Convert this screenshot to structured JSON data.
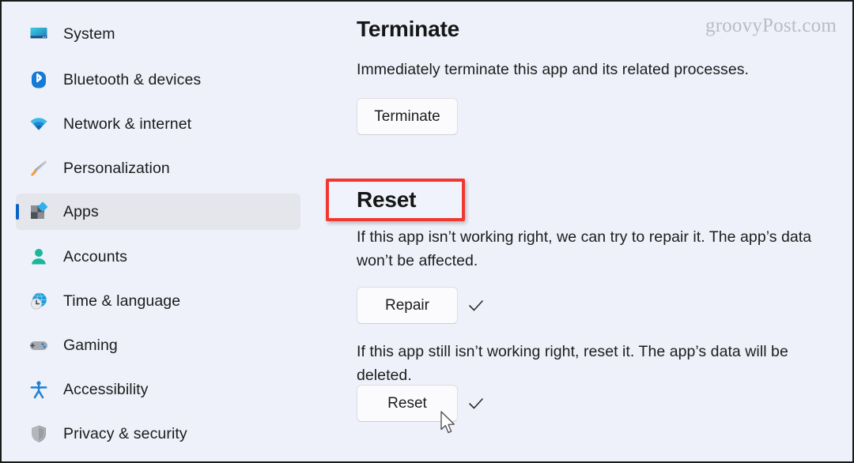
{
  "watermark": "groovyPost.com",
  "sidebar": {
    "items": [
      {
        "label": "System",
        "icon": "monitor-icon",
        "selected": false
      },
      {
        "label": "Bluetooth & devices",
        "icon": "bluetooth-icon",
        "selected": false
      },
      {
        "label": "Network & internet",
        "icon": "wifi-icon",
        "selected": false
      },
      {
        "label": "Personalization",
        "icon": "paintbrush-icon",
        "selected": false
      },
      {
        "label": "Apps",
        "icon": "apps-icon",
        "selected": true
      },
      {
        "label": "Accounts",
        "icon": "person-icon",
        "selected": false
      },
      {
        "label": "Time & language",
        "icon": "clock-globe-icon",
        "selected": false
      },
      {
        "label": "Gaming",
        "icon": "gamepad-icon",
        "selected": false
      },
      {
        "label": "Accessibility",
        "icon": "accessibility-icon",
        "selected": false
      },
      {
        "label": "Privacy & security",
        "icon": "shield-icon",
        "selected": false
      }
    ]
  },
  "content": {
    "terminate": {
      "heading": "Terminate",
      "description": "Immediately terminate this app and its related processes.",
      "button": "Terminate"
    },
    "reset": {
      "heading": "Reset",
      "repair_description": "If this app isn’t working right, we can try to repair it. The app’s data won’t be affected.",
      "repair_button": "Repair",
      "reset_description": "If this app still isn’t working right, reset it. The app’s data will be deleted.",
      "reset_button": "Reset"
    }
  },
  "annotation": {
    "target": "Reset",
    "color": "#f2372f"
  },
  "colors": {
    "page_background": "#eef1fa",
    "selection_background": "#e5e6ec",
    "selection_indicator": "#0a61c9",
    "annotation_red": "#f2372f",
    "watermark_gray": "#b9bcc6"
  }
}
